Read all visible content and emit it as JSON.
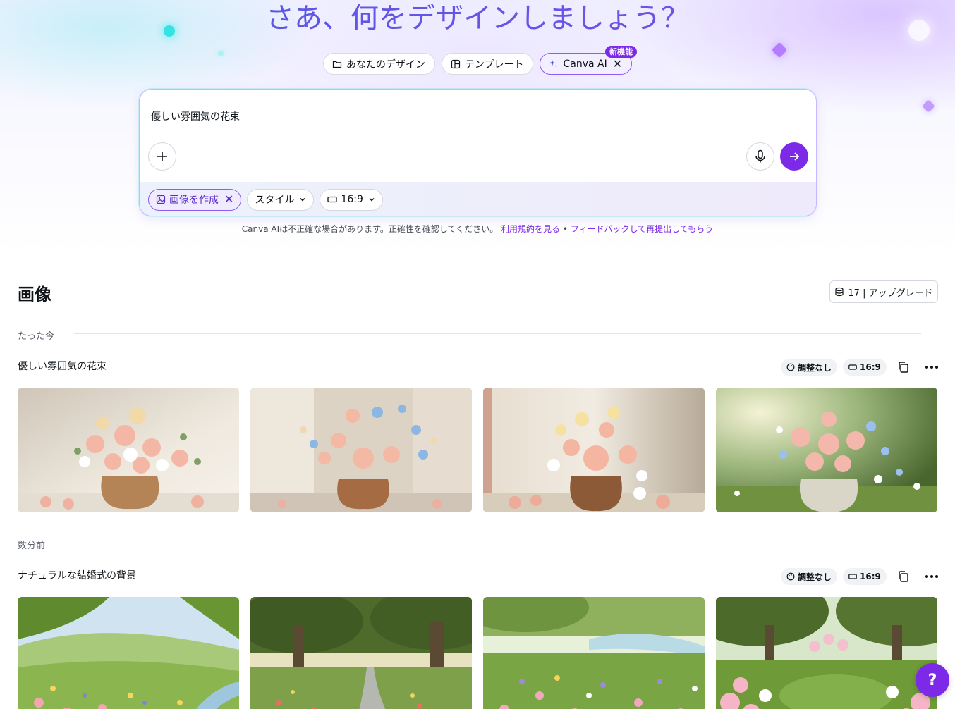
{
  "hero": {
    "title": "さあ、何をデザインしましょう？",
    "tabs": [
      {
        "label": "あなたのデザイン",
        "icon": "folder-icon"
      },
      {
        "label": "テンプレート",
        "icon": "template-icon"
      },
      {
        "label": "Canva AI",
        "icon": "sparkle-icon",
        "badge": "新機能",
        "active": true
      }
    ]
  },
  "prompt": {
    "text": "優しい雰囲気の花束",
    "chips": [
      {
        "label": "画像を作成",
        "icon": "image-icon",
        "active": true
      },
      {
        "label": "スタイル",
        "icon": "",
        "dropdown": true
      },
      {
        "label": "16:9",
        "icon": "aspect-ratio-icon",
        "dropdown": true
      }
    ]
  },
  "disclaimer": {
    "text": "Canva AIは不正確な場合があります。正確性を確認してください。",
    "terms_link": "利用規約を見る",
    "separator": "•",
    "feedback_link": "フィードバックして再提出してもらう"
  },
  "section": {
    "title": "画像",
    "credits": "17 | アップグレード"
  },
  "groups": [
    {
      "time_label": "たった今",
      "title": "優しい雰囲気の花束",
      "style_chip": "調整なし",
      "ratio_chip": "16:9"
    },
    {
      "time_label": "数分前",
      "title": "ナチュラルな結婚式の背景",
      "style_chip": "調整なし",
      "ratio_chip": "16:9"
    }
  ],
  "help": {
    "label": "?"
  },
  "colors": {
    "accent": "#7d2ae8",
    "title_gradient_start": "#4f59e3",
    "title_gradient_end": "#7d4fe8"
  }
}
